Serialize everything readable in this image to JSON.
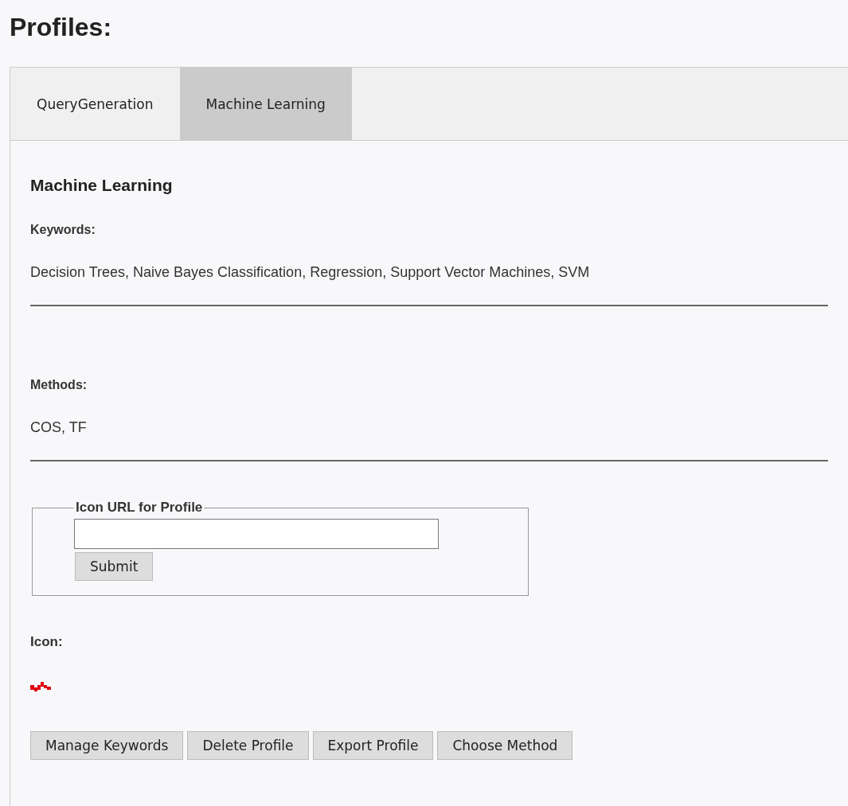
{
  "page_title": "Profiles:",
  "tabs": [
    {
      "label": "QueryGeneration",
      "selected": false
    },
    {
      "label": "Machine Learning",
      "selected": true
    }
  ],
  "profile": {
    "name": "Machine Learning",
    "sections": [
      {
        "label": "Keywords:",
        "value": "Decision Trees, Naive Bayes Classification, Regression, Support Vector Machines, SVM"
      },
      {
        "label": "Methods:",
        "value": "COS, TF"
      }
    ],
    "icon_form": {
      "legend": "Icon URL for Profile",
      "submit": "Submit"
    },
    "icon_label": "Icon:"
  },
  "buttons": [
    "Manage Keywords",
    "Delete Profile",
    "Export Profile",
    "Choose Method"
  ]
}
